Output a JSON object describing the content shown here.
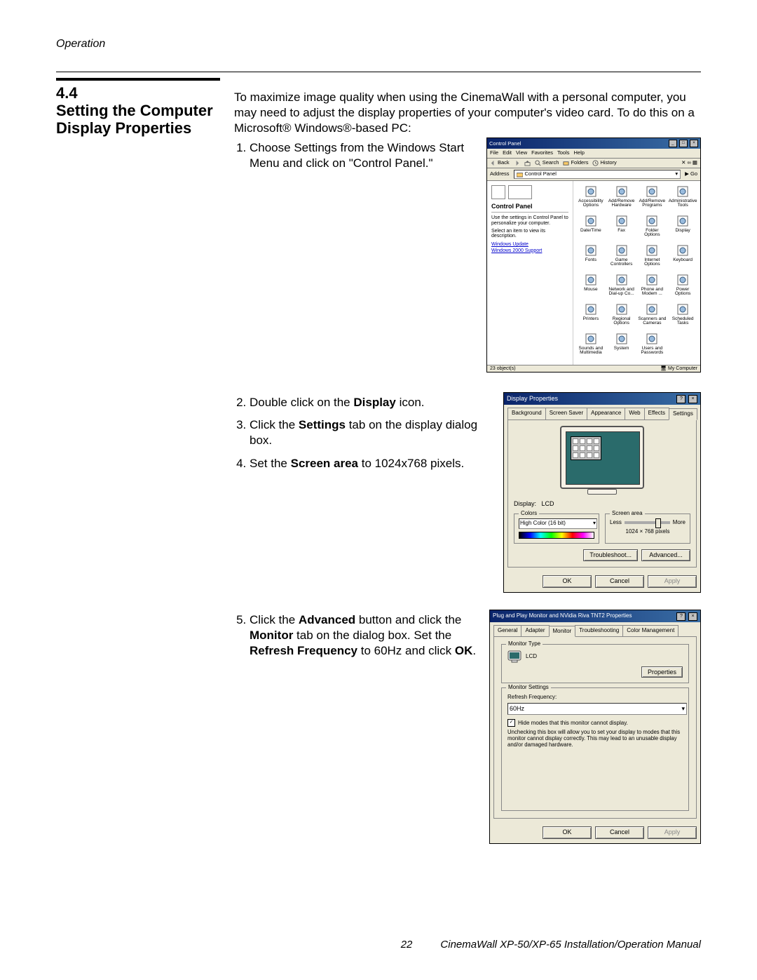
{
  "page": {
    "running_head": "Operation",
    "number": "22",
    "manual_title": "CinemaWall XP-50/XP-65 Installation/Operation Manual"
  },
  "section": {
    "number": "4.4",
    "title": "Setting the Computer Display Properties"
  },
  "intro": "To maximize image quality when using the CinemaWall with a personal computer, you may need to adjust the display properties of your computer's video card. To do this on a Microsoft® Windows®-based PC:",
  "step1": {
    "num": "1.",
    "prefix": "Choose Settings from the Windows Start Menu and click on \"Control Panel.\""
  },
  "step2": {
    "num": "2.",
    "before": "Double click on the ",
    "bold": "Display",
    "after": " icon."
  },
  "step3": {
    "num": "3.",
    "before": "Click the ",
    "bold": "Settings",
    "after": " tab on the display dialog box."
  },
  "step4": {
    "num": "4.",
    "before": "Set the ",
    "bold": "Screen area",
    "after": " to 1024x768 pixels."
  },
  "step5": {
    "num": "5.",
    "a": "Click the ",
    "b": "Advanced",
    "c": " button and click the ",
    "d": "Monitor",
    "e": " tab on the dialog box. Set the ",
    "f": "Refresh Frequency",
    "g": " to 60Hz and click ",
    "h": "OK",
    "i": "."
  },
  "cp": {
    "title": "Control Panel",
    "menu": [
      "File",
      "Edit",
      "View",
      "Favorites",
      "Tools",
      "Help"
    ],
    "tb_back": "Back",
    "tb_search": "Search",
    "tb_folders": "Folders",
    "tb_history": "History",
    "addr_label": "Address",
    "addr_value": "Control Panel",
    "go": "Go",
    "side_title": "Control Panel",
    "side_text1": "Use the settings in Control Panel to personalize your computer.",
    "side_text2": "Select an item to view its description.",
    "side_link1": "Windows Update",
    "side_link2": "Windows 2000 Support",
    "icons": [
      "Accessibility Options",
      "Add/Remove Hardware",
      "Add/Remove Programs",
      "Administrative Tools",
      "Date/Time",
      "Fax",
      "Folder Options",
      "Display",
      "Fonts",
      "Game Controllers",
      "Internet Options",
      "Keyboard",
      "Mouse",
      "Network and Dial-up Co...",
      "Phone and Modem ...",
      "Power Options",
      "Printers",
      "Regional Options",
      "Scanners and Cameras",
      "Scheduled Tasks",
      "Sounds and Multimedia",
      "System",
      "Users and Passwords"
    ],
    "status_left": "23 object(s)",
    "status_right": "My Computer"
  },
  "dp": {
    "title": "Display Properties",
    "tabs": [
      "Background",
      "Screen Saver",
      "Appearance",
      "Web",
      "Effects",
      "Settings"
    ],
    "display_label": "Display:",
    "display_value": "LCD",
    "group_colors": "Colors",
    "colors_value": "High Color (16 bit)",
    "group_screen": "Screen area",
    "less": "Less",
    "more": "More",
    "screen_value": "1024 × 768 pixels",
    "btn_trouble": "Troubleshoot...",
    "btn_adv": "Advanced...",
    "btn_ok": "OK",
    "btn_cancel": "Cancel",
    "btn_apply": "Apply"
  },
  "mp": {
    "title": "Plug and Play Monitor and NVidia Riva TNT2 Properties",
    "tabs": [
      "General",
      "Adapter",
      "Monitor",
      "Troubleshooting",
      "Color Management"
    ],
    "grp_type": "Monitor Type",
    "type_value": "LCD",
    "btn_props": "Properties",
    "grp_settings": "Monitor Settings",
    "refresh_label": "Refresh Frequency:",
    "refresh_value": "60Hz",
    "check_label": "Hide modes that this monitor cannot display.",
    "check_note": "Unchecking this box will allow you to set your display to modes that this monitor cannot display correctly. This may lead to an unusable display and/or damaged hardware.",
    "btn_ok": "OK",
    "btn_cancel": "Cancel",
    "btn_apply": "Apply"
  }
}
